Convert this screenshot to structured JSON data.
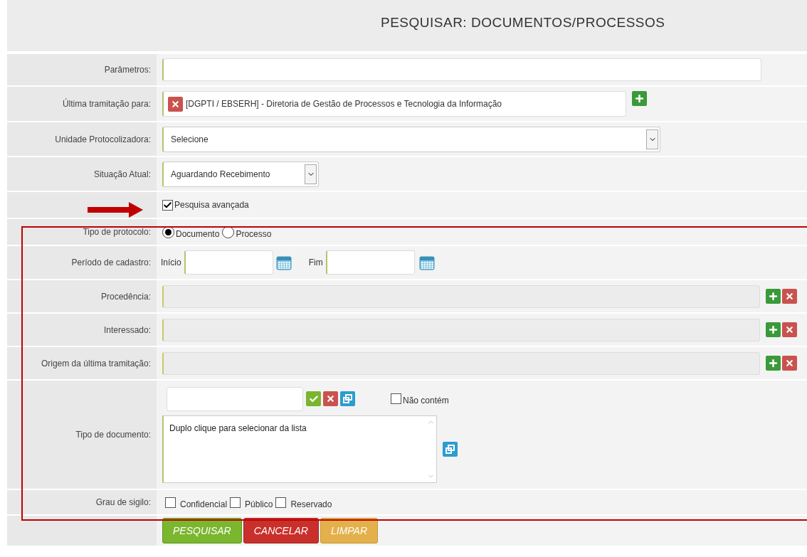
{
  "title": "PESQUISAR: DOCUMENTOS/PROCESSOS",
  "fields": [
    {
      "kind": "text",
      "label": "Parâmetros:"
    },
    {
      "kind": "tag",
      "label": "Última tramitação para:",
      "value": "[DGPTI / EBSERH] - Diretoria de Gestão de Processos e Tecnologia da Informação"
    },
    {
      "kind": "select",
      "label": "Unidade Protocolizadora:",
      "value": "Selecione"
    },
    {
      "kind": "short-select",
      "label": "Situação Atual:",
      "value": "Aguardando Recebimento"
    },
    {
      "kind": "checkbox",
      "text": "Pesquisa avançada",
      "checked": true
    },
    {
      "kind": "radio",
      "label": "Tipo de protocolo:",
      "options": [
        {
          "label": "Documento",
          "selected": true
        },
        {
          "label": "Processo",
          "selected": false
        }
      ]
    },
    {
      "kind": "daterange",
      "label": "Período de cadastro:",
      "start_label": "Início",
      "end_label": "Fim"
    },
    {
      "kind": "lookup",
      "label": "Procedência:"
    },
    {
      "kind": "lookup",
      "label": "Interessado:"
    },
    {
      "kind": "lookup",
      "label": "Origem da última tramitação:"
    },
    {
      "kind": "doctype",
      "label": "Tipo de documento:",
      "exclude": {
        "label": "Não contém",
        "checked": false
      },
      "placeholder": "Duplo clique para selecionar da lista"
    },
    {
      "kind": "checkgroup",
      "label": "Grau de sigilo:",
      "options": [
        {
          "label": "Confidencial",
          "checked": false
        },
        {
          "label": "Público",
          "checked": false
        },
        {
          "label": "Reservado",
          "checked": false
        }
      ]
    }
  ],
  "buttons": [
    {
      "label": "PESQUISAR",
      "kind": "primary"
    },
    {
      "label": "CANCELAR",
      "kind": "danger"
    },
    {
      "label": "LIMPAR",
      "kind": "warning"
    }
  ]
}
